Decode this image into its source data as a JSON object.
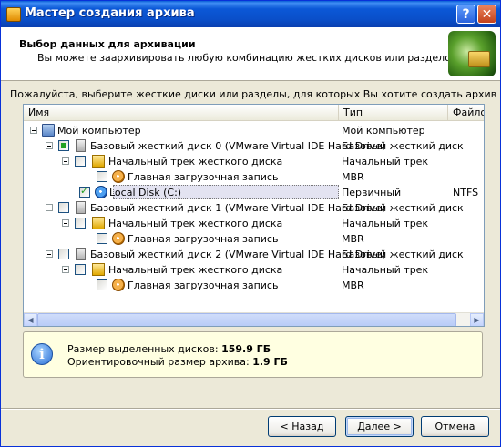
{
  "window": {
    "title": "Мастер создания архива",
    "help_label": "?",
    "close_label": "✕"
  },
  "header": {
    "title": "Выбор данных для архивации",
    "subtitle": "Вы можете заархивировать любую комбинацию жестких дисков или разделов."
  },
  "instruction": "Пожалуйста, выберите жесткие диски или разделы, для которых Вы хотите создать архив",
  "columns": {
    "name": "Имя",
    "type": "Тип",
    "fs": "Файло"
  },
  "tree": [
    {
      "name": "Мой компьютер",
      "type": "Мой компьютер",
      "fs": ""
    },
    {
      "name": "Базовый жесткий диск 0 (VMware Virtual IDE Hard Drive)",
      "type": "Базовый жесткий диск",
      "fs": ""
    },
    {
      "name": "Начальный трек жесткого диска",
      "type": "Начальный трек",
      "fs": ""
    },
    {
      "name": "Главная загрузочная запись",
      "type": "MBR",
      "fs": ""
    },
    {
      "name": "Local Disk (C:)",
      "type": "Первичный",
      "fs": "NTFS"
    },
    {
      "name": "Базовый жесткий диск 1 (VMware Virtual IDE Hard Drive)",
      "type": "Базовый жесткий диск",
      "fs": ""
    },
    {
      "name": "Начальный трек жесткого диска",
      "type": "Начальный трек",
      "fs": ""
    },
    {
      "name": "Главная загрузочная запись",
      "type": "MBR",
      "fs": ""
    },
    {
      "name": "Базовый жесткий диск 2 (VMware Virtual IDE Hard Drive)",
      "type": "Базовый жесткий диск",
      "fs": ""
    },
    {
      "name": "Начальный трек жесткого диска",
      "type": "Начальный трек",
      "fs": ""
    },
    {
      "name": "Главная загрузочная запись",
      "type": "MBR",
      "fs": ""
    }
  ],
  "scroll": {
    "left": "◀",
    "right": "▶"
  },
  "info": {
    "icon": "i",
    "selected_label": "Размер выделенных дисков:",
    "selected_value": "159.9 ГБ",
    "archive_label": "Ориентировочный размер архива:",
    "archive_value": "1.9 ГБ"
  },
  "buttons": {
    "back": "< Назад",
    "next": "Далее >",
    "cancel": "Отмена"
  }
}
